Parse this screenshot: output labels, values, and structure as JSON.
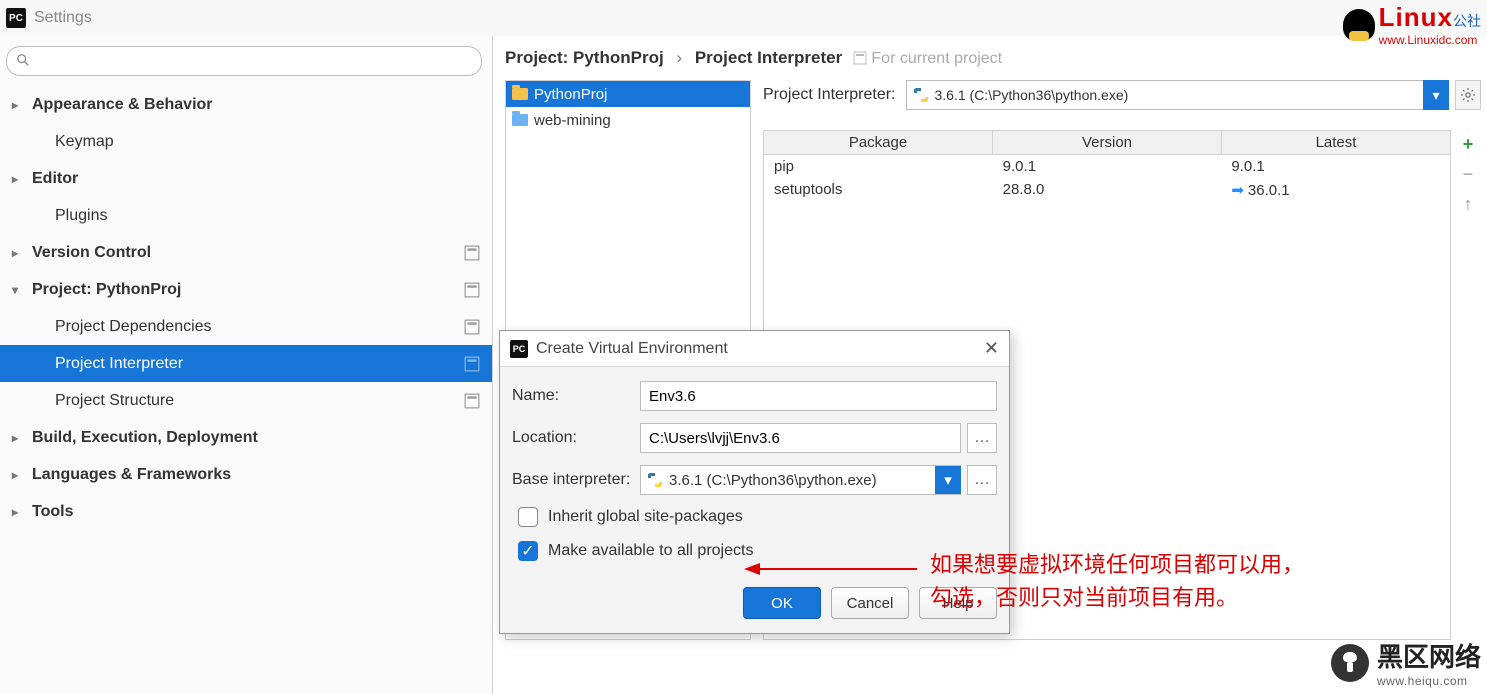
{
  "window": {
    "title": "Settings"
  },
  "search": {
    "placeholder": ""
  },
  "sidebar": {
    "items": [
      {
        "label": "Appearance & Behavior",
        "expandable": true,
        "level": 1
      },
      {
        "label": "Keymap",
        "level": 2
      },
      {
        "label": "Editor",
        "expandable": true,
        "level": 1
      },
      {
        "label": "Plugins",
        "level": 2
      },
      {
        "label": "Version Control",
        "expandable": true,
        "level": 1,
        "suffix": true
      },
      {
        "label": "Project: PythonProj",
        "expandable": true,
        "expanded": true,
        "level": 1,
        "suffix": true
      },
      {
        "label": "Project Dependencies",
        "level": 2,
        "suffix": true
      },
      {
        "label": "Project Interpreter",
        "level": 2,
        "selected": true,
        "suffix": true
      },
      {
        "label": "Project Structure",
        "level": 2,
        "suffix": true
      },
      {
        "label": "Build, Execution, Deployment",
        "expandable": true,
        "level": 1
      },
      {
        "label": "Languages & Frameworks",
        "expandable": true,
        "level": 1
      },
      {
        "label": "Tools",
        "expandable": true,
        "level": 1
      }
    ]
  },
  "breadcrumb": {
    "parent": "Project: PythonProj",
    "current": "Project Interpreter",
    "suffix": "For current project"
  },
  "projects": [
    {
      "name": "PythonProj",
      "selected": true
    },
    {
      "name": "web-mining",
      "selected": false
    }
  ],
  "interpreter": {
    "label": "Project Interpreter:",
    "value": "3.6.1 (C:\\Python36\\python.exe)"
  },
  "packages": {
    "headers": [
      "Package",
      "Version",
      "Latest"
    ],
    "rows": [
      {
        "name": "pip",
        "version": "9.0.1",
        "latest": "9.0.1",
        "upgrade": false
      },
      {
        "name": "setuptools",
        "version": "28.8.0",
        "latest": "36.0.1",
        "upgrade": true
      }
    ]
  },
  "dialog": {
    "title": "Create Virtual Environment",
    "name_label": "Name:",
    "name_value": "Env3.6",
    "location_label": "Location:",
    "location_value": "C:\\Users\\lvjj\\Env3.6",
    "base_label": "Base interpreter:",
    "base_value": "3.6.1 (C:\\Python36\\python.exe)",
    "inherit_label": "Inherit global site-packages",
    "inherit_checked": false,
    "available_label": "Make available to all projects",
    "available_checked": true,
    "buttons": {
      "ok": "OK",
      "cancel": "Cancel",
      "help": "Help"
    }
  },
  "annotation": {
    "line1": "如果想要虚拟环境任何项目都可以用，",
    "line2": "勾选，否则只对当前项目有用。"
  },
  "watermark_linux": {
    "brand": "Linux",
    "cn": "公社",
    "url": "www.Linuxidc.com"
  },
  "watermark_heiqu": {
    "brand": "黑区网络",
    "url": "www.heiqu.com"
  }
}
